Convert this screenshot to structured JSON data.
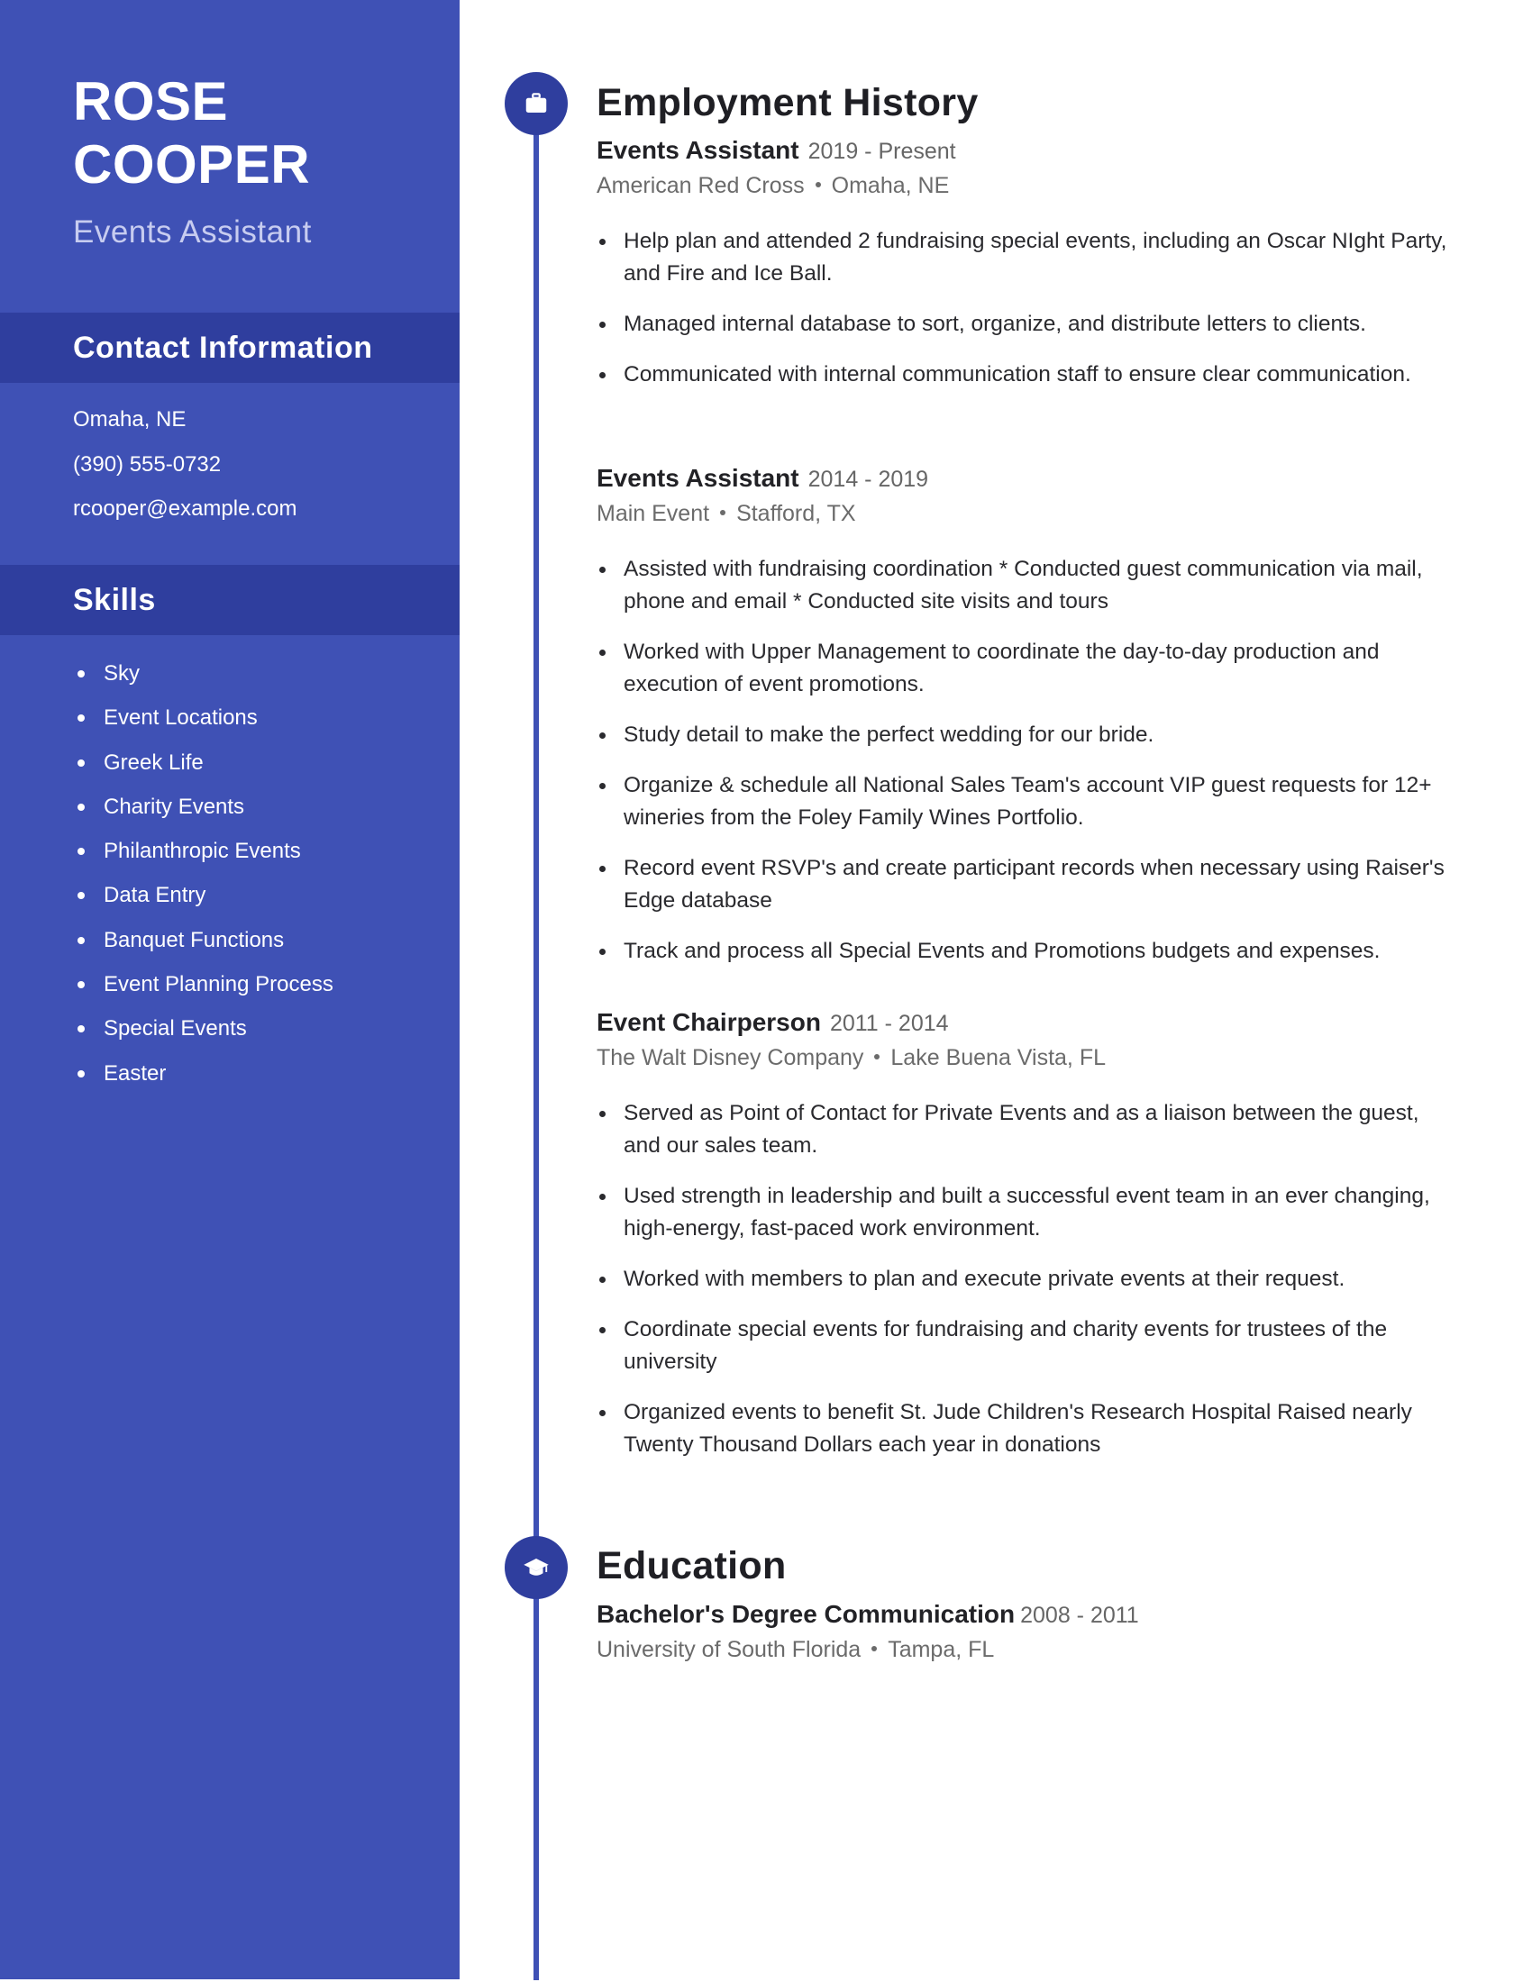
{
  "profile": {
    "first_name": "ROSE",
    "last_name": "COOPER",
    "title": "Events Assistant"
  },
  "colors": {
    "sidebar": "#3f51b5",
    "band": "#2f3e9e",
    "accent": "#3f51b5"
  },
  "contact": {
    "heading": "Contact Information",
    "items": [
      "Omaha, NE",
      "(390) 555-0732",
      "rcooper@example.com"
    ]
  },
  "skills": {
    "heading": "Skills",
    "items": [
      "Sky",
      "Event Locations",
      "Greek Life",
      "Charity Events",
      "Philanthropic Events",
      "Data Entry",
      "Banquet Functions",
      "Event Planning Process",
      "Special Events",
      "Easter"
    ]
  },
  "employment": {
    "heading": "Employment History",
    "icon": "briefcase-icon",
    "jobs": [
      {
        "title": "Events Assistant",
        "dates": "2019 - Present",
        "company": "American Red Cross",
        "location": "Omaha, NE",
        "bullets": [
          "Help plan and attended 2 fundraising special events, including an Oscar NIght Party, and Fire and Ice Ball.",
          "Managed internal database to sort, organize, and distribute letters to clients.",
          "Communicated with internal communication staff to ensure clear communication."
        ]
      },
      {
        "title": "Events Assistant",
        "dates": "2014 - 2019",
        "company": "Main Event",
        "location": "Stafford, TX",
        "bullets": [
          "Assisted with fundraising coordination * Conducted guest communication via mail, phone and email * Conducted site visits and tours",
          "Worked with Upper Management to coordinate the day-to-day production and execution of event promotions.",
          "Study detail to make the perfect wedding for our bride.",
          "Organize & schedule all National Sales Team's account VIP guest requests for 12+ wineries from the Foley Family Wines Portfolio.",
          "Record event RSVP's and create participant records when necessary using Raiser's Edge database",
          "Track and process all Special Events and Promotions budgets and expenses."
        ]
      },
      {
        "title": "Event Chairperson",
        "dates": "2011 - 2014",
        "company": "The Walt Disney Company",
        "location": "Lake Buena Vista, FL",
        "bullets": [
          "Served as Point of Contact for Private Events and as a liaison between the guest, and our sales team.",
          "Used strength in leadership and built a successful event team in an ever changing, high-energy, fast-paced work environment.",
          "Worked with members to plan and execute private events at their request.",
          "Coordinate special events for fundraising and charity events for trustees of the university",
          "Organized events to benefit St. Jude Children's Research Hospital Raised nearly Twenty Thousand Dollars each year in donations"
        ]
      }
    ]
  },
  "education": {
    "heading": "Education",
    "icon": "graduation-cap-icon",
    "entries": [
      {
        "degree": "Bachelor's Degree Communication",
        "dates": "2008 - 2011",
        "school": "University of South Florida",
        "location": "Tampa, FL"
      }
    ]
  }
}
